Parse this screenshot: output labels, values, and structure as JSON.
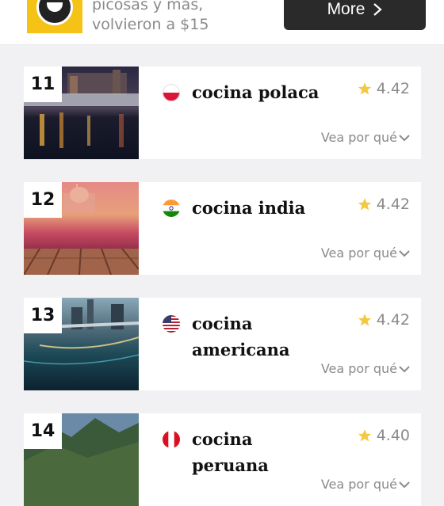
{
  "banner": {
    "line1": "picosas y más,",
    "line2": "volvieron a $15",
    "button_label": "More"
  },
  "colors": {
    "star": "#f5c842",
    "button_bg": "#2a2a2a",
    "muted_text": "#8a8a8a"
  },
  "items": [
    {
      "rank": "11",
      "name": "cocina polaca",
      "rating": "4.42",
      "why": "Vea por qué",
      "flag": "flag-poland-icon"
    },
    {
      "rank": "12",
      "name": "cocina india",
      "rating": "4.42",
      "why": "Vea por qué",
      "flag": "flag-india-icon"
    },
    {
      "rank": "13",
      "name": "cocina americana",
      "rating": "4.42",
      "why": "Vea por qué",
      "flag": "flag-usa-icon"
    },
    {
      "rank": "14",
      "name": "cocina peruana",
      "rating": "4.40",
      "why": "Vea por qué",
      "flag": "flag-peru-icon"
    }
  ]
}
